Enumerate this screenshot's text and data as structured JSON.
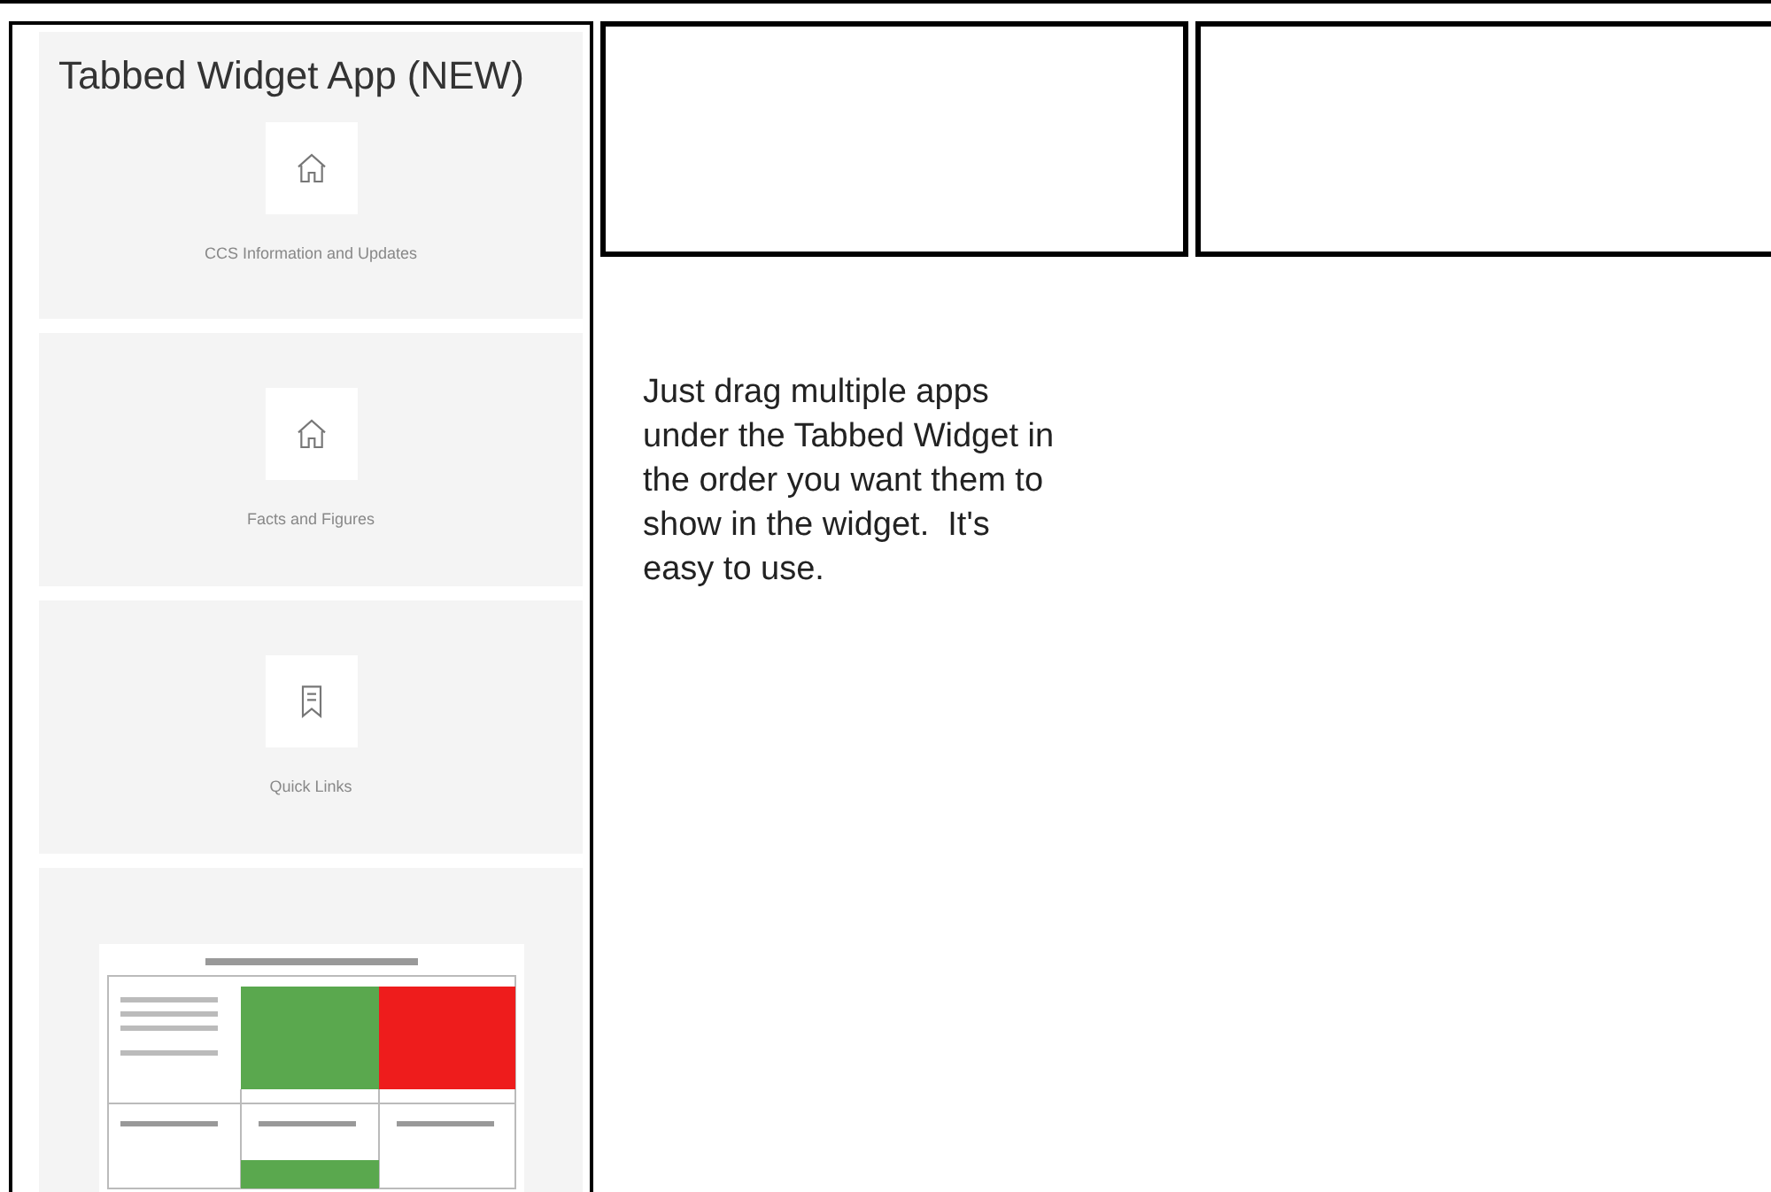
{
  "app": {
    "title": "Tabbed Widget App (NEW)"
  },
  "tiles": [
    {
      "kind": "page",
      "label": "CCS Information and Updates"
    },
    {
      "kind": "page",
      "label": "Facts and Figures"
    },
    {
      "kind": "links",
      "label": "Quick Links"
    },
    {
      "kind": "image"
    }
  ],
  "instructions": "Just drag multiple apps under the Tabbed Widget in the order you want them to show in the widget.  It's easy to use."
}
